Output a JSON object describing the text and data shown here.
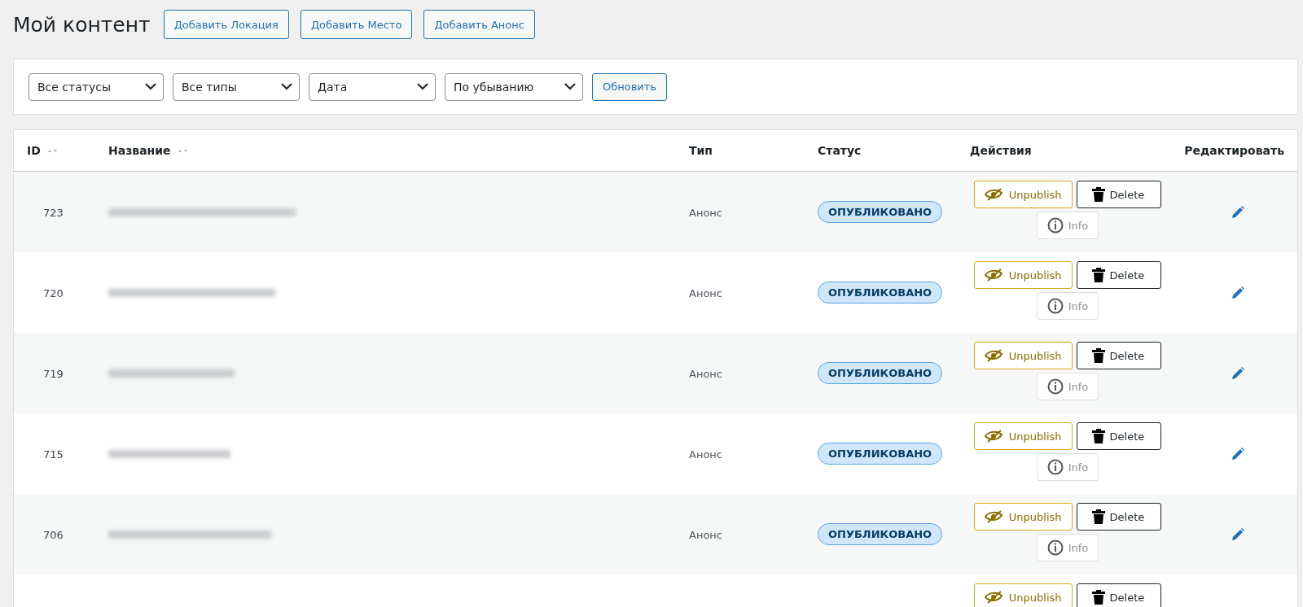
{
  "page": {
    "title": "Мой контент"
  },
  "add_buttons": [
    "Добавить Локация",
    "Добавить Место",
    "Добавить Анонс"
  ],
  "filters": {
    "selects": [
      {
        "value": "Все статусы"
      },
      {
        "value": "Все типы"
      },
      {
        "value": "Дата"
      },
      {
        "value": "По убыванию"
      }
    ],
    "submit": "Обновить"
  },
  "table": {
    "columns": [
      {
        "label": "ID",
        "sortable": true
      },
      {
        "label": "Название",
        "sortable": true
      },
      {
        "label": "Тип",
        "sortable": false
      },
      {
        "label": "Статус",
        "sortable": false
      },
      {
        "label": "Действия",
        "sortable": false
      },
      {
        "label": "Редактировать",
        "sortable": false
      }
    ],
    "rows": [
      {
        "id": "723",
        "type": "Анонс",
        "status": "ОПУБЛИКОВАНО",
        "unpublish": "Unpublish",
        "delete": "Delete",
        "info": "Info"
      },
      {
        "id": "720",
        "type": "Анонс",
        "status": "ОПУБЛИКОВАНО",
        "unpublish": "Unpublish",
        "delete": "Delete",
        "info": "Info"
      },
      {
        "id": "719",
        "type": "Анонс",
        "status": "ОПУБЛИКОВАНО",
        "unpublish": "Unpublish",
        "delete": "Delete",
        "info": "Info"
      },
      {
        "id": "715",
        "type": "Анонс",
        "status": "ОПУБЛИКОВАНО",
        "unpublish": "Unpublish",
        "delete": "Delete",
        "info": "Info"
      },
      {
        "id": "706",
        "type": "Анонс",
        "status": "ОПУБЛИКОВАНО",
        "unpublish": "Unpublish",
        "delete": "Delete",
        "info": "Info"
      },
      {
        "unpublish": "Unpublish",
        "delete": "Delete"
      }
    ]
  }
}
